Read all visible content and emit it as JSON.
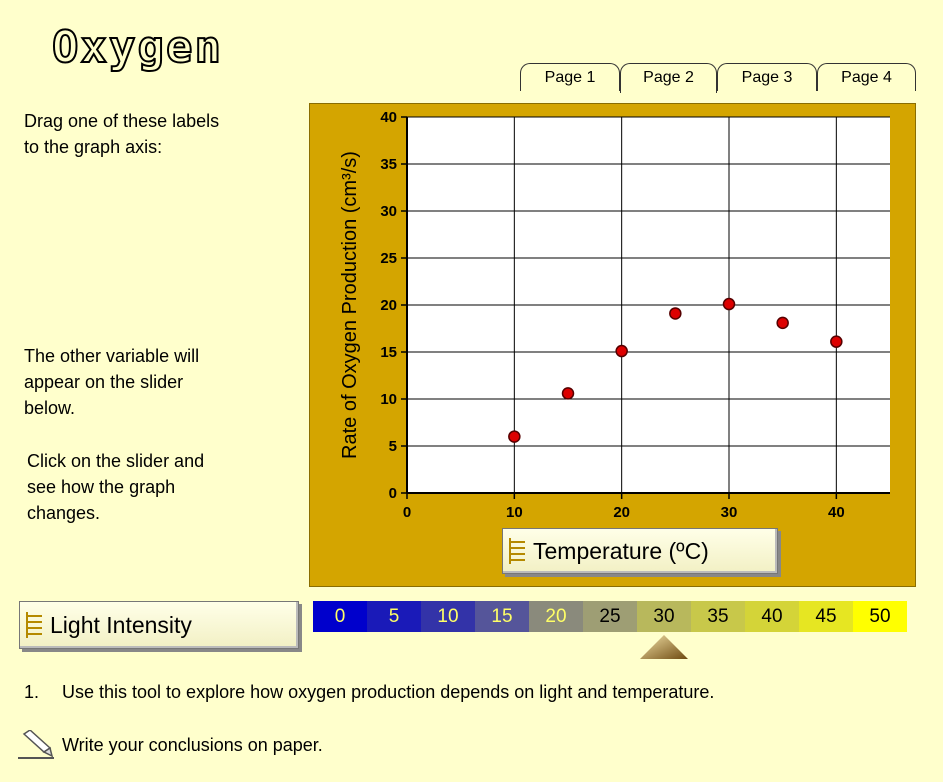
{
  "title": "Oxygen",
  "tabs": [
    "Page 1",
    "Page 2",
    "Page 3",
    "Page 4"
  ],
  "active_tab": 1,
  "instructions": {
    "drag": [
      "Drag one of these labels",
      "to the graph axis:"
    ],
    "slider_note": [
      "The other variable will",
      "appear on the slider",
      "below."
    ],
    "click_note": [
      "Click on the slider and",
      "see how the graph",
      "changes."
    ]
  },
  "labels": {
    "x_axis_label": "Temperature (ºC)",
    "spare_label": "Light Intensity"
  },
  "slider": {
    "values": [
      "0",
      "5",
      "10",
      "15",
      "20",
      "25",
      "30",
      "35",
      "40",
      "45",
      "50"
    ],
    "colors": [
      "#0000cc",
      "#1a1ab8",
      "#3333a8",
      "#55559a",
      "#8a8a7c",
      "#9e9e74",
      "#b8b85c",
      "#c8c84a",
      "#d4d438",
      "#e6e622",
      "#ffff00"
    ],
    "text_colors": [
      "#ffff66",
      "#ffff66",
      "#ffff66",
      "#ffff66",
      "#ffff66",
      "#000000",
      "#000000",
      "#000000",
      "#000000",
      "#000000",
      "#000000"
    ],
    "selected_index": 6
  },
  "question": {
    "number": "1.",
    "text": "Use this tool to explore how oxygen production depends on light and temperature."
  },
  "note_text": "Write your conclusions on paper.",
  "icons": {
    "note": "pencil-icon",
    "grip": "grip-lines-icon",
    "pointer": "triangle-pointer-icon"
  },
  "chart_data": {
    "type": "scatter",
    "ylabel": "Rate of Oxygen Production (cm³/s)",
    "xlabel": "Temperature (ºC)",
    "xlim": [
      0,
      45
    ],
    "ylim": [
      0,
      40
    ],
    "xticks": [
      0,
      10,
      20,
      30,
      40
    ],
    "yticks": [
      0,
      5,
      10,
      15,
      20,
      25,
      30,
      35,
      40
    ],
    "vgrid": [
      10,
      20,
      30,
      40
    ],
    "grid": true,
    "point_color": "#dd0000",
    "x": [
      10,
      15,
      20,
      25,
      30,
      35,
      40
    ],
    "y": [
      6,
      10.6,
      15.1,
      19.1,
      20.1,
      18.1,
      16.1
    ]
  }
}
